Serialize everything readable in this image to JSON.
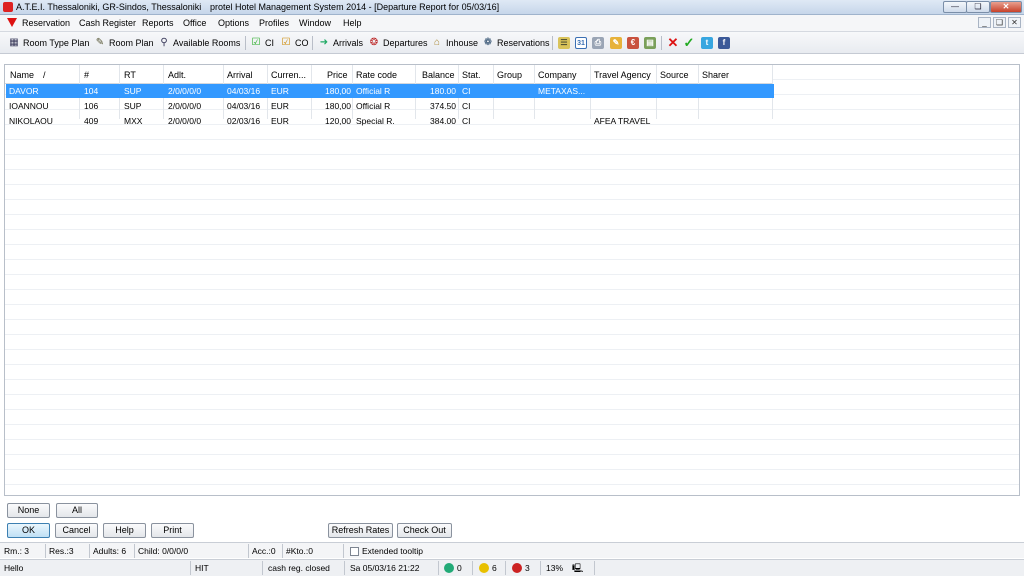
{
  "window": {
    "title_location": "A.T.E.I. Thessaloniki, GR-Sindos, Thessaloniki",
    "title_app": "protel Hotel Management System 2014 - [Departure Report for 05/03/16]"
  },
  "menu": [
    "Reservation",
    "Cash Register",
    "Reports",
    "Office",
    "Options",
    "Profiles",
    "Window",
    "Help"
  ],
  "toolbar": {
    "room_type_plan": "Room Type Plan",
    "room_plan": "Room Plan",
    "available_rooms": "Available Rooms",
    "ci": "CI",
    "co": "CO",
    "arrivals": "Arrivals",
    "departures": "Departures",
    "inhouse": "Inhouse",
    "reservations": "Reservations",
    "calendar_day": "31"
  },
  "table": {
    "columns": [
      "Name",
      "#",
      "RT",
      "Adlt.",
      "Arrival",
      "Curren...",
      "Price",
      "Rate code",
      "Balance",
      "Stat.",
      "Group",
      "Company",
      "Travel Agency",
      "Source",
      "Sharer"
    ],
    "sort_indicator": "/",
    "rows": [
      {
        "name": "DAVOR",
        "num": "104",
        "rt": "SUP",
        "adlt": "2/0/0/0/0",
        "arrival": "04/03/16",
        "currency": "EUR",
        "price": "180,00",
        "rate_code": "Official R",
        "balance": "180.00",
        "stat": "CI",
        "group": "",
        "company": "METAXAS...",
        "travel_agency": "",
        "source": "",
        "sharer": ""
      },
      {
        "name": "IOANNOU",
        "num": "106",
        "rt": "SUP",
        "adlt": "2/0/0/0/0",
        "arrival": "04/03/16",
        "currency": "EUR",
        "price": "180,00",
        "rate_code": "Official R",
        "balance": "374.50",
        "stat": "CI",
        "group": "",
        "company": "",
        "travel_agency": "",
        "source": "",
        "sharer": ""
      },
      {
        "name": "NIKOLAOU",
        "num": "409",
        "rt": "MXX",
        "adlt": "2/0/0/0/0",
        "arrival": "02/03/16",
        "currency": "EUR",
        "price": "120,00",
        "rate_code": "Special R.",
        "balance": "384.00",
        "stat": "CI",
        "group": "",
        "company": "",
        "travel_agency": "AFEA TRAVEL",
        "source": "",
        "sharer": ""
      }
    ]
  },
  "buttons": {
    "none": "None",
    "all": "All",
    "ok": "OK",
    "cancel": "Cancel",
    "help": "Help",
    "print": "Print",
    "refresh_rates": "Refresh Rates",
    "check_out": "Check Out"
  },
  "summary": {
    "rooms": "Rm.: 3",
    "reservations": "Res.:3",
    "adults": "Adults: 6",
    "children": "Child: 0/0/0/0",
    "acc": "Acc.:0",
    "kto": "#Kto.:0",
    "extended_tooltip": "Extended tooltip"
  },
  "status": {
    "message": "Hello",
    "mode": "HIT",
    "cash_register": "cash reg. closed",
    "datetime": "Sa 05/03/16 21:22",
    "count_1": "0",
    "count_2": "6",
    "count_3": "3",
    "percent": "13%"
  },
  "colors": {
    "selection": "#3399ff",
    "logo_red": "#d11111"
  }
}
